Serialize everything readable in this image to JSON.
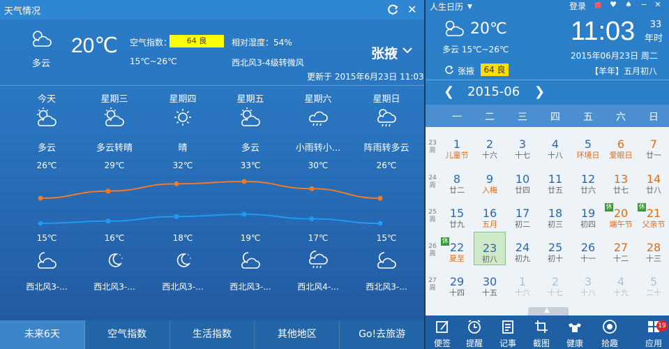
{
  "weather": {
    "title": "天气情况",
    "current": {
      "icon": "partly-cloudy-icon",
      "condition": "多云",
      "temperature": "20℃",
      "aqi_label": "空气指数：",
      "aqi_value": "64 良",
      "humidity": "相对湿度：54%",
      "range": "15℃~26℃",
      "wind": "西北风3-4级转微风",
      "city": "张掖",
      "updated": "更新于 2015年6月23日 11:03"
    },
    "forecast": [
      {
        "day": "今天",
        "icon": "partly-cloudy-icon",
        "condition": "多云",
        "high": "26℃",
        "low": "15℃",
        "night_icon": "cloudy-night-icon",
        "wind": "西北风3-..."
      },
      {
        "day": "星期三",
        "icon": "partly-cloudy-icon",
        "condition": "多云转晴",
        "high": "29℃",
        "low": "16℃",
        "night_icon": "moon-icon",
        "wind": "西北风3-..."
      },
      {
        "day": "星期四",
        "icon": "sun-icon",
        "condition": "晴",
        "high": "32℃",
        "low": "18℃",
        "night_icon": "moon-icon",
        "wind": "西北风3-..."
      },
      {
        "day": "星期五",
        "icon": "partly-cloudy-icon",
        "condition": "多云",
        "high": "33℃",
        "low": "19℃",
        "night_icon": "cloudy-night-icon",
        "wind": "西北风3-..."
      },
      {
        "day": "星期六",
        "icon": "rain-icon",
        "condition": "小雨转小...",
        "high": "30℃",
        "low": "17℃",
        "night_icon": "rain-night-icon",
        "wind": "西北风4-..."
      },
      {
        "day": "星期日",
        "icon": "shower-icon",
        "condition": "阵雨转多云",
        "high": "26℃",
        "low": "15℃",
        "night_icon": "cloudy-night-icon",
        "wind": "西北风3-..."
      }
    ],
    "temps": {
      "high": [
        26,
        29,
        32,
        33,
        30,
        26
      ],
      "low": [
        15,
        16,
        18,
        19,
        17,
        15
      ],
      "high_color": "#f07a28",
      "low_color": "#1e9af0"
    },
    "tabs": [
      "未来6天",
      "空气指数",
      "生活指数",
      "其他地区",
      "Go!去旅游"
    ]
  },
  "calendar": {
    "app_name": "人生日历",
    "login": "登录",
    "current_temp": "20℃",
    "condition": "多云 15℃~26℃",
    "time": "11:03",
    "day_num": "33",
    "day_unit": "年时",
    "date": "2015年06月23日 周二",
    "city": "张掖",
    "aqi": "64 良",
    "lunar": "【羊年】五月初八",
    "month": "2015-06",
    "weekdays": [
      "一",
      "二",
      "三",
      "四",
      "五",
      "六",
      "日"
    ],
    "weeks": [
      {
        "num": "23",
        "label": "周",
        "days": [
          {
            "d": "1",
            "l": "儿童节",
            "lc": "orange"
          },
          {
            "d": "2",
            "l": "十六"
          },
          {
            "d": "3",
            "l": "十七"
          },
          {
            "d": "4",
            "l": "十八"
          },
          {
            "d": "5",
            "l": "环境日",
            "lc": "orange"
          },
          {
            "d": "6",
            "l": "爱眼日",
            "dc": "orange",
            "lc": "orange"
          },
          {
            "d": "7",
            "l": "廿一",
            "dc": "orange"
          }
        ]
      },
      {
        "num": "24",
        "label": "周",
        "days": [
          {
            "d": "8",
            "l": "廿二"
          },
          {
            "d": "9",
            "l": "入梅",
            "lc": "orange"
          },
          {
            "d": "10",
            "l": "廿四"
          },
          {
            "d": "11",
            "l": "廿五"
          },
          {
            "d": "12",
            "l": "廿六"
          },
          {
            "d": "13",
            "l": "廿七",
            "dc": "orange"
          },
          {
            "d": "14",
            "l": "廿八",
            "dc": "orange"
          }
        ]
      },
      {
        "num": "25",
        "label": "周",
        "days": [
          {
            "d": "15",
            "l": "廿九"
          },
          {
            "d": "16",
            "l": "五月",
            "lc": "orange"
          },
          {
            "d": "17",
            "l": "初二"
          },
          {
            "d": "18",
            "l": "初三"
          },
          {
            "d": "19",
            "l": "初四"
          },
          {
            "d": "20",
            "l": "端午节",
            "dc": "orange",
            "lc": "orange",
            "hol": "休"
          },
          {
            "d": "21",
            "l": "父亲节",
            "dc": "orange",
            "lc": "orange",
            "hol": "休"
          }
        ]
      },
      {
        "num": "26",
        "label": "周",
        "days": [
          {
            "d": "22",
            "l": "夏至",
            "lc": "orange",
            "hol": "休"
          },
          {
            "d": "23",
            "l": "初八",
            "today": true
          },
          {
            "d": "24",
            "l": "初九"
          },
          {
            "d": "25",
            "l": "初十"
          },
          {
            "d": "26",
            "l": "十一"
          },
          {
            "d": "27",
            "l": "十二",
            "dc": "orange"
          },
          {
            "d": "28",
            "l": "十三",
            "dc": "orange"
          }
        ]
      },
      {
        "num": "27",
        "label": "周",
        "days": [
          {
            "d": "29",
            "l": "十四"
          },
          {
            "d": "30",
            "l": "十五"
          },
          {
            "d": "1",
            "l": "十六",
            "faded": true
          },
          {
            "d": "2",
            "l": "十七",
            "faded": true
          },
          {
            "d": "3",
            "l": "十八",
            "faded": true
          },
          {
            "d": "4",
            "l": "十九",
            "faded": true
          },
          {
            "d": "5",
            "l": "二十",
            "faded": true
          }
        ]
      }
    ],
    "toolbar": [
      {
        "label": "便签",
        "icon": "note-icon"
      },
      {
        "label": "提醒",
        "icon": "alarm-icon"
      },
      {
        "label": "记事",
        "icon": "memo-icon"
      },
      {
        "label": "截图",
        "icon": "screenshot-icon"
      },
      {
        "label": "健康",
        "icon": "fitness-icon"
      },
      {
        "label": "拾趣",
        "icon": "fun-icon"
      },
      {
        "label": "应用",
        "icon": "apps-icon"
      }
    ],
    "apps_badge": "19"
  }
}
